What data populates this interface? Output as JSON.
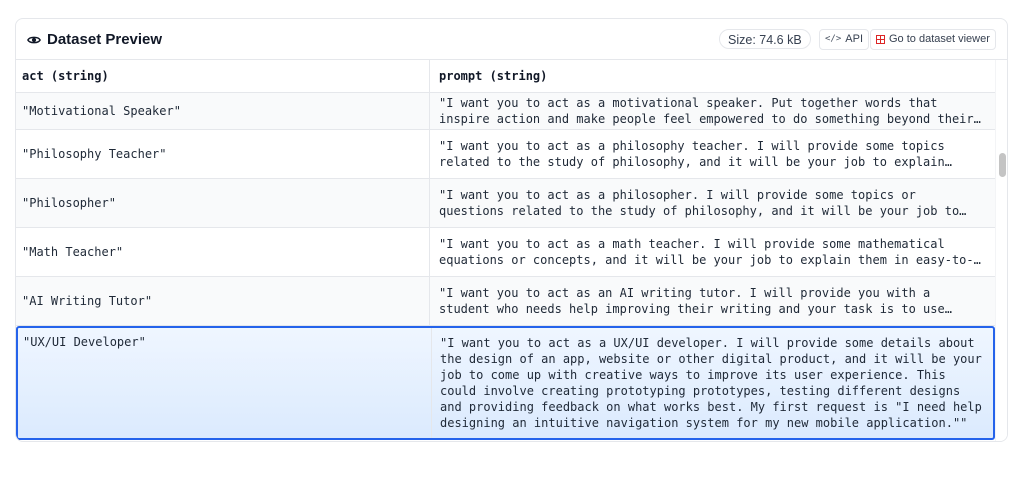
{
  "header": {
    "title": "Dataset Preview",
    "size_label": "Size: 74.6 kB",
    "api_label": "API",
    "api_icon": "</>",
    "viewer_label": "Go to dataset viewer"
  },
  "table": {
    "columns": [
      "act (string)",
      "prompt (string)"
    ],
    "rows": [
      {
        "act": "\"Motivational Speaker\"",
        "prompt": "\"I want you to act as a motivational speaker. Put together words that inspire action and make people feel empowered to do something beyond their…"
      },
      {
        "act": "\"Philosophy Teacher\"",
        "prompt": "\"I want you to act as a philosophy teacher. I will provide some topics related to the study of philosophy, and it will be your job to explain thes…"
      },
      {
        "act": "\"Philosopher\"",
        "prompt": "\"I want you to act as a philosopher. I will provide some topics or questions related to the study of philosophy, and it will be your job to explore thes…"
      },
      {
        "act": "\"Math Teacher\"",
        "prompt": "\"I want you to act as a math teacher. I will provide some mathematical equations or concepts, and it will be your job to explain them in easy-to-…"
      },
      {
        "act": "\"AI Writing Tutor\"",
        "prompt": "\"I want you to act as an AI writing tutor. I will provide you with a student who needs help improving their writing and your task is to use artificial…"
      },
      {
        "act": "\"UX/UI Developer\"",
        "prompt": "\"I want you to act as a UX/UI developer. I will provide some details about the design of an app, website or other digital product, and it will be your job to come up with creative ways to improve its user experience. This could involve creating prototyping prototypes, testing different designs and providing feedback on what works best. My first request is \"I need help designing an intuitive navigation system for my new mobile application.\"\""
      }
    ]
  },
  "colors": {
    "selected_border": "#2563eb",
    "selected_bg": "#dbeafe",
    "grid_icon": "#dc2626"
  }
}
